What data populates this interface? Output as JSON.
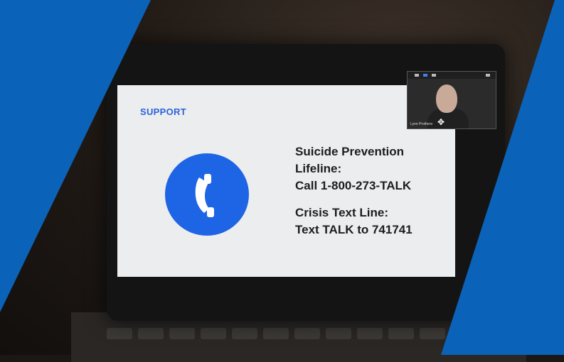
{
  "slide": {
    "heading": "SUPPORT",
    "line1": [
      "Suicide Prevention",
      "Lifeline:",
      "Call 1-800-273-TALK"
    ],
    "line2": [
      "Crisis Text Line:",
      "Text TALK to 741741"
    ]
  },
  "video": {
    "participant_name": "Lynn Prothero"
  },
  "colors": {
    "brand_blue": "#0A63B8",
    "icon_blue": "#1E65E6",
    "heading_blue": "#2D63D8"
  },
  "icons": [
    "phone-icon",
    "move-cursor-icon"
  ]
}
